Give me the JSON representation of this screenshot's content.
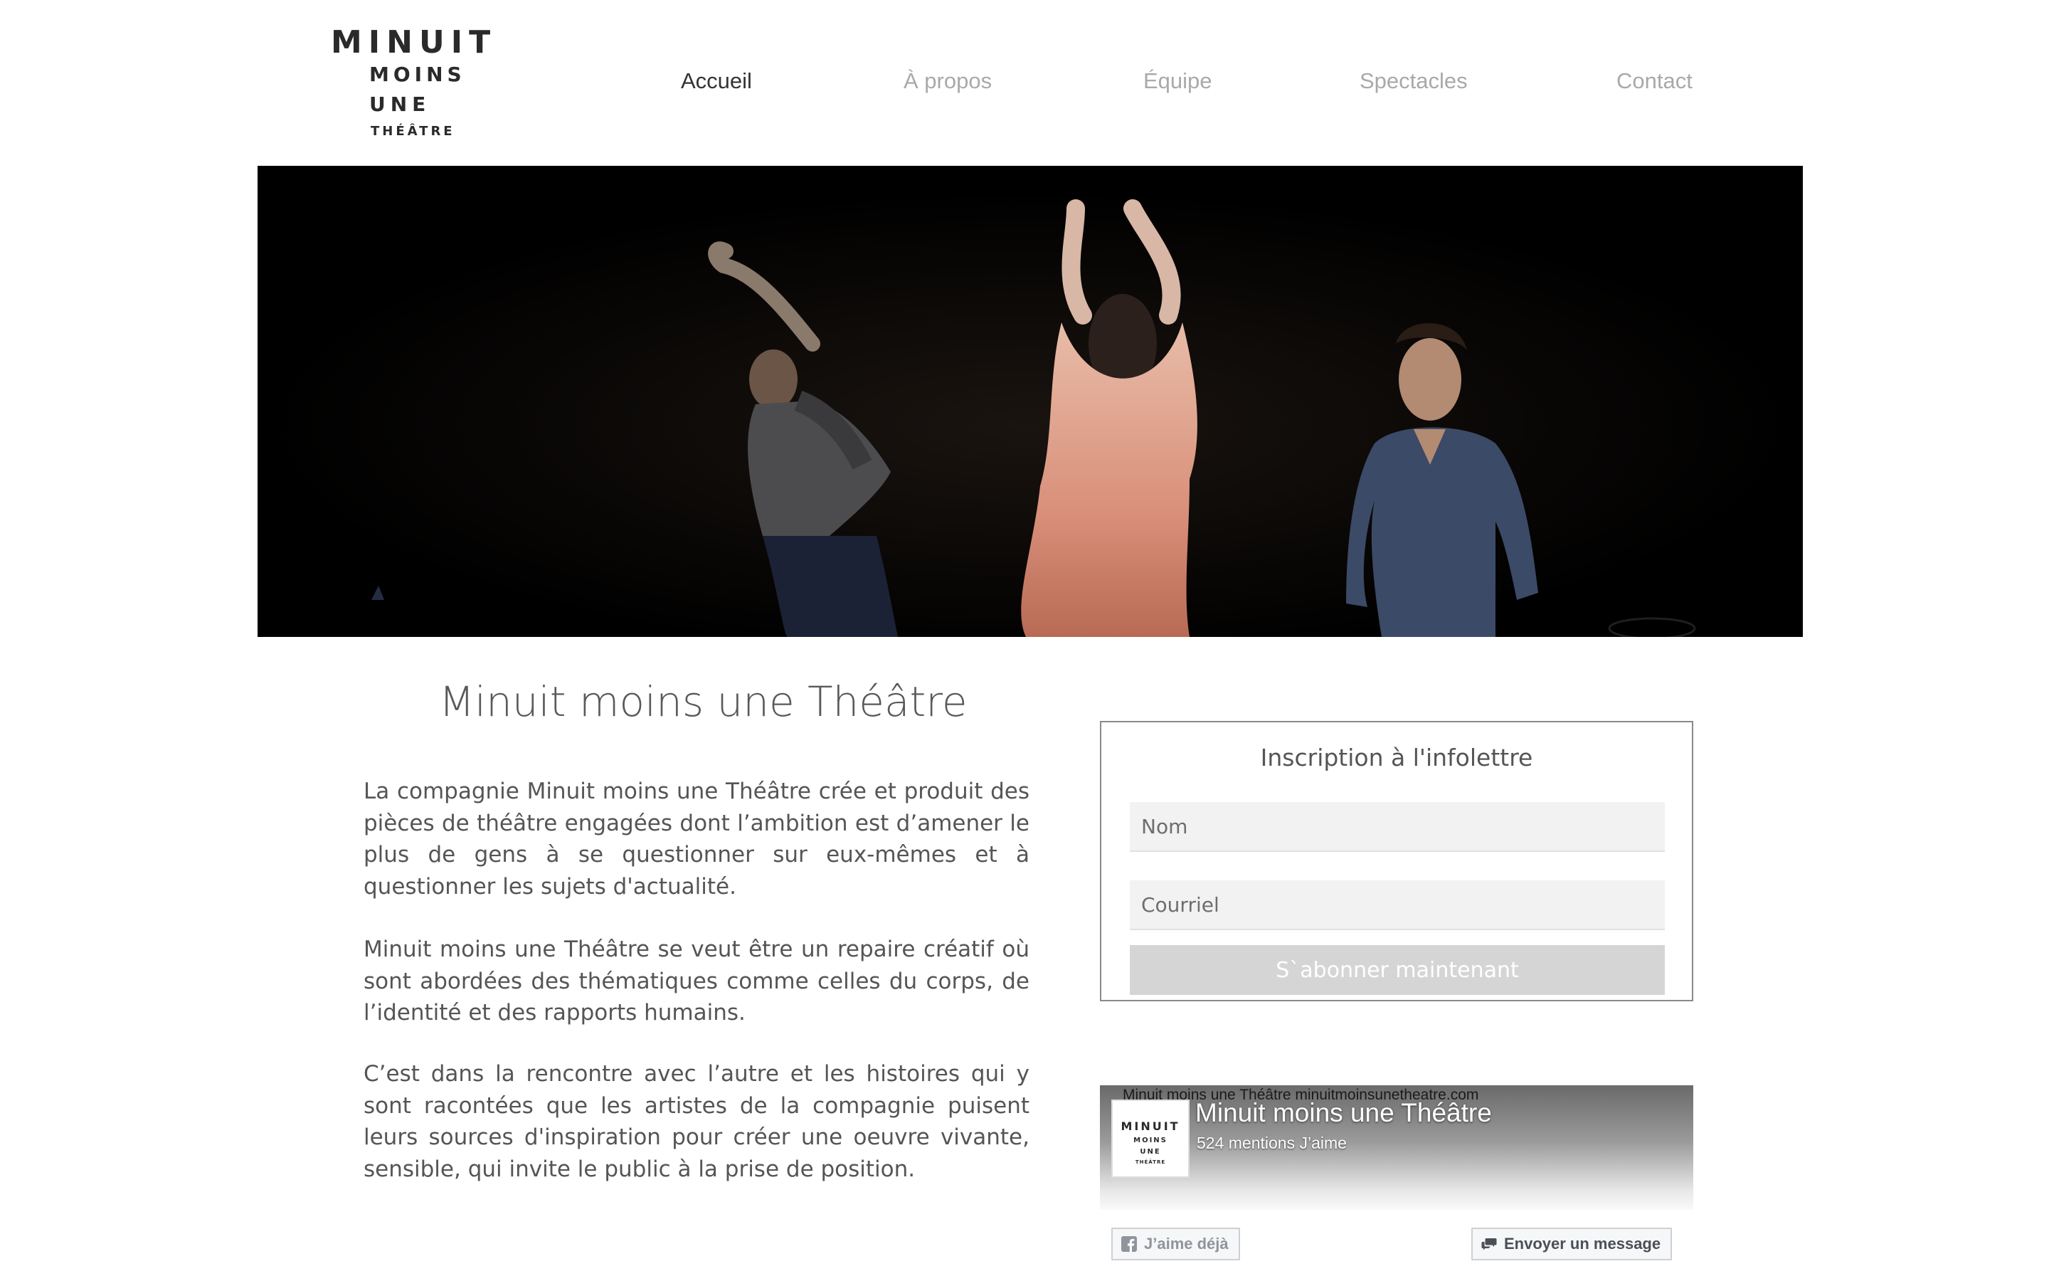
{
  "logo": {
    "line1": "MINUIT",
    "line2": "MOINS",
    "line3": "UNE",
    "line4": "THÉÂTRE"
  },
  "nav": {
    "items": [
      {
        "label": "Accueil",
        "active": true
      },
      {
        "label": "À propos",
        "active": false
      },
      {
        "label": "Équipe",
        "active": false
      },
      {
        "label": "Spectacles",
        "active": false
      },
      {
        "label": "Contact",
        "active": false
      }
    ]
  },
  "main": {
    "title": "Minuit moins une Théâtre",
    "paragraphs": [
      "La compagnie Minuit moins une Théâtre crée et produit des pièces de théâtre engagées dont l’ambition est d’amener le plus de gens à se questionner sur eux-mêmes et à questionner les sujets d'actualité.",
      "Minuit moins une Théâtre se veut être un repaire créatif où sont abordées des thématiques comme celles du corps, de l’identité et des rapports humains.",
      "C’est dans la rencontre avec l’autre et les histoires qui y sont racontées que les artistes de la compagnie puisent leurs sources d'inspiration pour créer une oeuvre vivante, sensible, qui invite le public à la prise de position."
    ]
  },
  "newsletter": {
    "title": "Inscription à l'infolettre",
    "name_placeholder": "Nom",
    "email_placeholder": "Courriel",
    "submit_label": "S`abonner maintenant"
  },
  "facebook": {
    "cover_text": "Minuit moins une Théâtre minuitmoinsunetheatre.com",
    "page_name": "Minuit moins une Théâtre",
    "likes": "524 mentions J’aime",
    "like_button": "J’aime déjà",
    "message_button": "Envoyer un message",
    "avatar": {
      "line1": "MINUIT",
      "line2": "MOINS",
      "line3": "UNE",
      "line4": "THÉÂTRE"
    }
  },
  "colors": {
    "nav_active": "#333333",
    "nav_inactive": "#a9a9a9",
    "hero_background": "#000000",
    "submit_background": "#d5d5d5"
  }
}
